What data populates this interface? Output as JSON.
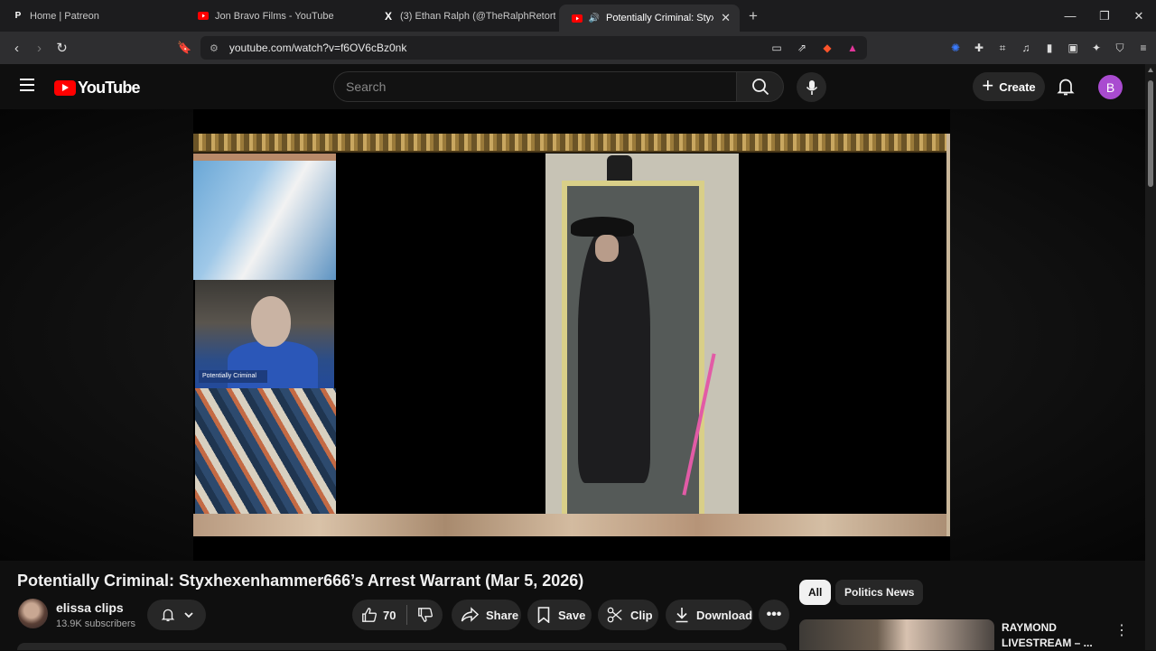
{
  "browser": {
    "tabs": [
      {
        "title": "Home | Patreon",
        "icon": "patreon-icon"
      },
      {
        "title": "Jon Bravo Films - YouTube",
        "icon": "youtube-icon"
      },
      {
        "title": "(3) Ethan Ralph (@TheRalphRetort) /",
        "icon": "x-icon"
      },
      {
        "title": "Potentially Criminal: Styxhexe",
        "icon": "youtube-icon",
        "active": true
      }
    ],
    "url": "youtube.com/watch?v=f6OV6cBz0nk"
  },
  "youtube": {
    "logo_text": "YouTube",
    "search_placeholder": "Search",
    "create_label": "Create",
    "avatar_letter": "B"
  },
  "video": {
    "title": "Potentially Criminal: Styxhexenhammer666’s Arrest Warrant (Mar 5, 2026)",
    "overlay_label": "Potentially Criminal",
    "channel_name": "elissa clips",
    "subscribers": "13.9K subscribers",
    "like_count": "70",
    "share_label": "Share",
    "save_label": "Save",
    "clip_label": "Clip",
    "download_label": "Download"
  },
  "sidebar": {
    "chips": [
      "All",
      "Politics News"
    ],
    "recommendation_title": "RAYMOND LIVESTREAM – ..."
  },
  "colors": {
    "youtube_red": "#ff0000",
    "avatar_purple": "#a94bd0",
    "background": "#0f0f0f"
  }
}
